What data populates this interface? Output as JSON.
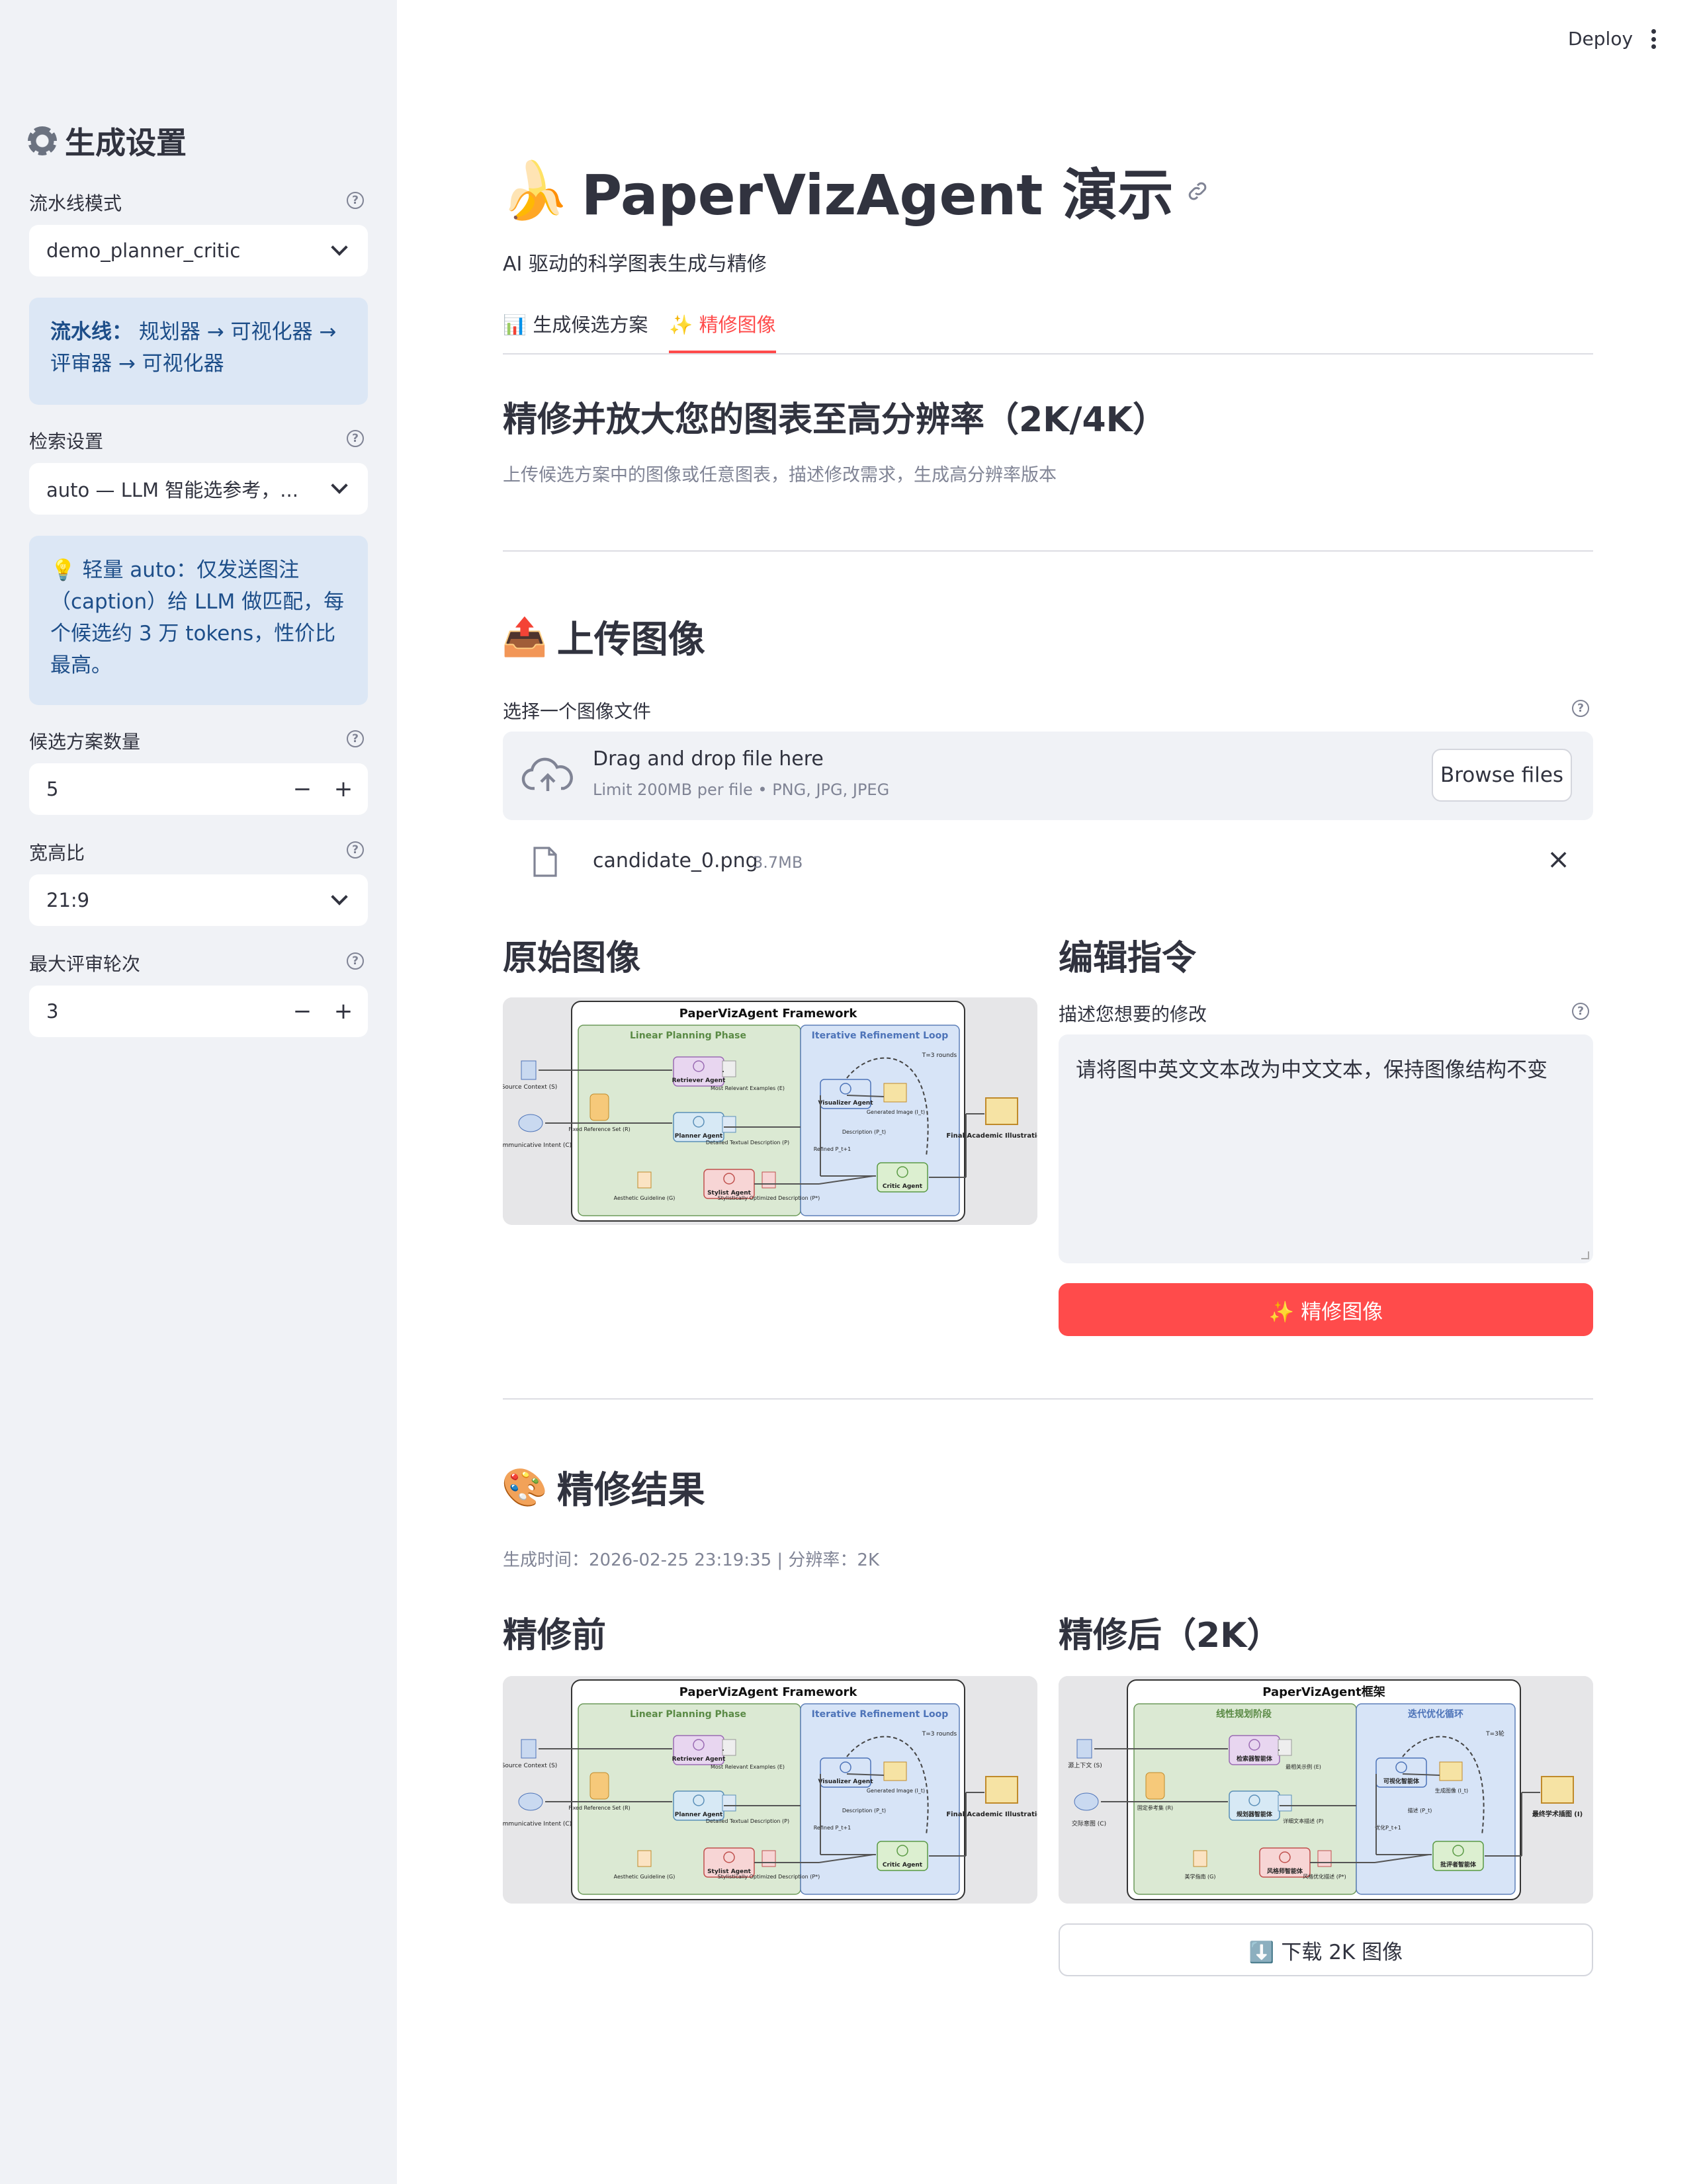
{
  "header": {
    "deploy_label": "Deploy"
  },
  "sidebar": {
    "title": "生成设置",
    "pipeline_mode": {
      "label": "流水线模式",
      "value": "demo_planner_critic"
    },
    "pipeline_info": {
      "prefix": "流水线：",
      "text": "规划器 → 可视化器 → 评审器 → 可视化器"
    },
    "retrieval": {
      "label": "检索设置",
      "value": "auto — LLM 智能选参考，..."
    },
    "retrieval_info": {
      "text": "💡 轻量 auto：仅发送图注（caption）给 LLM 做匹配，每个候选约 3 万 tokens，性价比最高。"
    },
    "candidates": {
      "label": "候选方案数量",
      "value": "5"
    },
    "aspect_ratio": {
      "label": "宽高比",
      "value": "21:9"
    },
    "max_rounds": {
      "label": "最大评审轮次",
      "value": "3"
    }
  },
  "main": {
    "emoji": "🍌",
    "title": "PaperVizAgent 演示",
    "subtitle": "AI 驱动的科学图表生成与精修",
    "tabs": [
      {
        "label": "📊 生成候选方案"
      },
      {
        "label": "✨ 精修图像"
      }
    ],
    "refine_heading": "精修并放大您的图表至高分辨率（2K/4K）",
    "refine_caption": "上传候选方案中的图像或任意图表，描述修改需求，生成高分辨率版本",
    "upload_heading": "上传图像",
    "upload_emoji": "📤",
    "file_label": "选择一个图像文件",
    "dropzone": {
      "title": "Drag and drop file here",
      "limit": "Limit 200MB per file • PNG, JPG, JPEG",
      "browse": "Browse files"
    },
    "file": {
      "name": "candidate_0.png",
      "size": "3.7MB"
    },
    "original_heading": "原始图像",
    "edit_heading": "编辑指令",
    "edit_label": "描述您想要的修改",
    "edit_value": "请将图中英文文本改为中文文本，保持图像结构不变",
    "refine_button": "✨ 精修图像",
    "result_heading": "精修结果",
    "result_emoji": "🎨",
    "result_meta": "生成时间：2026-02-25 23:19:35 | 分辨率：2K",
    "before_heading": "精修前",
    "after_heading": "精修后（2K）",
    "download_button": "⬇️ 下载 2K 图像"
  },
  "diagram_en": {
    "title": "PaperVizAgent Framework",
    "phase1": "Linear Planning Phase",
    "phase2": "Iterative Refinement Loop",
    "source": "Source Context (S)",
    "intent": "Communicative Intent (C)",
    "fixed": "Fixed Reference Set (R)",
    "retriever": "Retriever Agent",
    "planner": "Planner Agent",
    "stylist": "Stylist Agent",
    "visualizer": "Visualizer Agent",
    "critic": "Critic Agent",
    "final": "Final Academic Illustration (I)",
    "rounds": "T=3 rounds",
    "examples": "Most Relevant Examples (E)",
    "detailed": "Detailed Textual Description (P)",
    "aesthetic": "Aesthetic Guideline (G)",
    "styl_opt": "Stylistically Optimized Description (P*)",
    "generated": "Generated Image (I_t)",
    "description": "Description (P_t)",
    "refined": "Refined P_t+1"
  },
  "diagram_zh": {
    "title": "PaperVizAgent框架",
    "phase1": "线性规划阶段",
    "phase2": "迭代优化循环",
    "source": "源上下文 (S)",
    "intent": "交际意图 (C)",
    "fixed": "固定参考集 (R)",
    "retriever": "检索器智能体",
    "planner": "规划器智能体",
    "stylist": "风格师智能体",
    "visualizer": "可视化智能体",
    "critic": "批评者智能体",
    "final": "最终学术插图 (I)",
    "rounds": "T=3轮",
    "examples": "最相关示例 (E)",
    "detailed": "详细文本描述 (P)",
    "aesthetic": "美学指南 (G)",
    "styl_opt": "风格优化描述 (P*)",
    "generated": "生成图像 (I_t)",
    "description": "描述 (P_t)",
    "refined": "优化P_t+1"
  },
  "colors": {
    "accent": "#ff4b4b",
    "sidebar_bg": "#f0f2f6",
    "info_bg": "#dce7f5",
    "info_text": "#1d4e89"
  }
}
